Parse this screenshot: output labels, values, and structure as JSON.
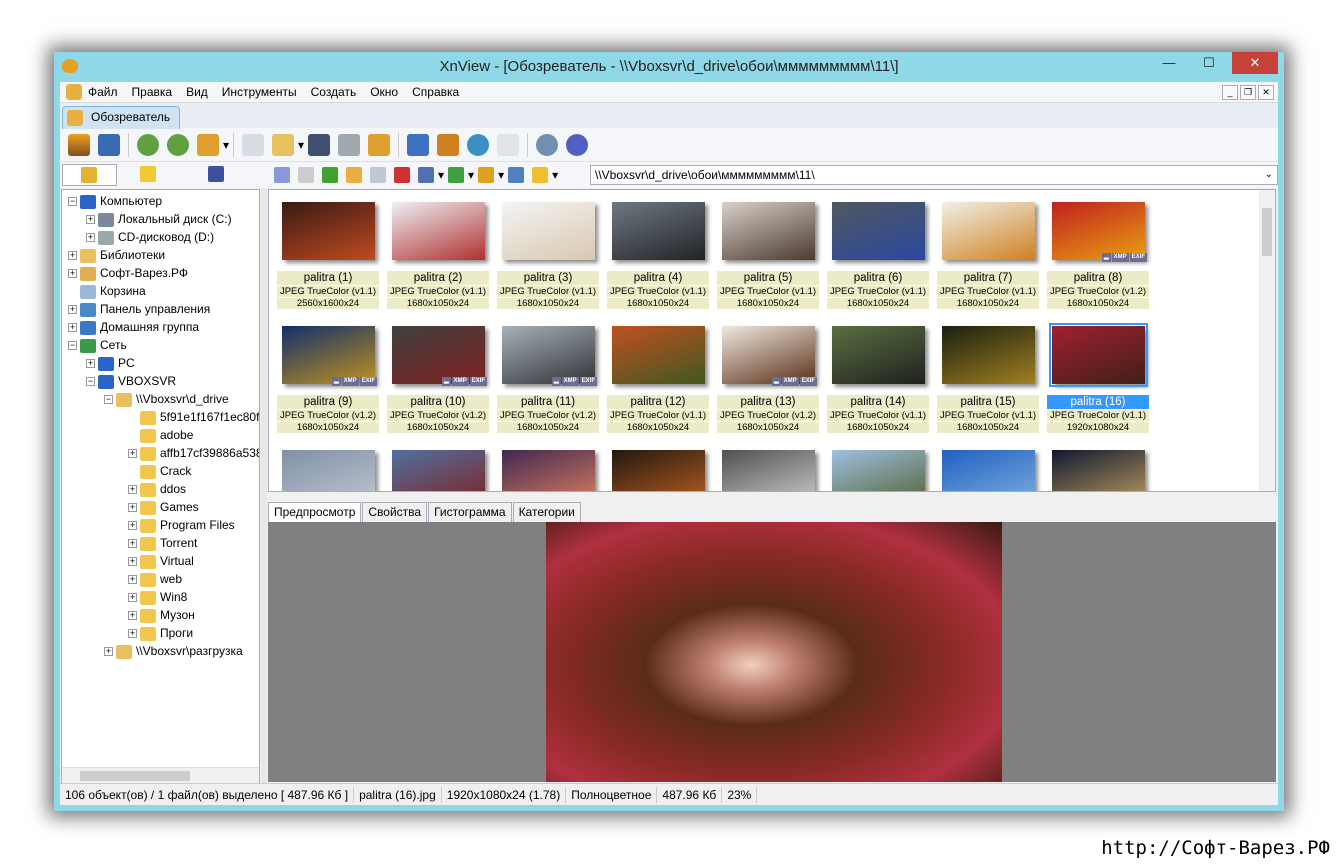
{
  "window": {
    "title": "XnView - [Обозреватель - \\\\Vboxsvr\\d_drive\\обои\\ммммммммм\\11\\]",
    "minimize": "—",
    "maximize": "☐",
    "close": "✕"
  },
  "menu": [
    "Файл",
    "Правка",
    "Вид",
    "Инструменты",
    "Создать",
    "Окно",
    "Справка"
  ],
  "doc_tab": "Обозреватель",
  "address": "\\\\Vboxsvr\\d_drive\\обои\\ммммммммм\\11\\",
  "tree": [
    {
      "label": "Компьютер",
      "level": 0,
      "exp": "-",
      "color": "#2a64c8"
    },
    {
      "label": "Локальный диск (C:)",
      "level": 1,
      "exp": "+",
      "color": "#7a8a9a"
    },
    {
      "label": "CD-дисковод (D:)",
      "level": 1,
      "exp": "+",
      "color": "#9aa"
    },
    {
      "label": "Библиотеки",
      "level": 0,
      "exp": "+",
      "color": "#e8c060"
    },
    {
      "label": "Софт-Варез.РФ",
      "level": 0,
      "exp": "+",
      "color": "#e0b050"
    },
    {
      "label": "Корзина",
      "level": 0,
      "exp": "",
      "color": "#9ab8d8"
    },
    {
      "label": "Панель управления",
      "level": 0,
      "exp": "+",
      "color": "#4a88c8"
    },
    {
      "label": "Домашняя группа",
      "level": 0,
      "exp": "+",
      "color": "#3a78c8"
    },
    {
      "label": "Сеть",
      "level": 0,
      "exp": "-",
      "color": "#3a9a48"
    },
    {
      "label": "PC",
      "level": 1,
      "exp": "+",
      "color": "#2a64c8"
    },
    {
      "label": "VBOXSVR",
      "level": 1,
      "exp": "-",
      "color": "#2a64c8"
    },
    {
      "label": "\\\\Vboxsvr\\d_drive",
      "level": 2,
      "exp": "-",
      "color": "#e8c060"
    },
    {
      "label": "5f91e1f167f1ec80f",
      "level": 3,
      "exp": "",
      "color": "#f0c850"
    },
    {
      "label": "adobe",
      "level": 3,
      "exp": "",
      "color": "#f0c850"
    },
    {
      "label": "affb17cf39886a538",
      "level": 3,
      "exp": "+",
      "color": "#f0c850"
    },
    {
      "label": "Crack",
      "level": 3,
      "exp": "",
      "color": "#f0c850"
    },
    {
      "label": "ddos",
      "level": 3,
      "exp": "+",
      "color": "#f0c850"
    },
    {
      "label": "Games",
      "level": 3,
      "exp": "+",
      "color": "#f0c850"
    },
    {
      "label": "Program Files",
      "level": 3,
      "exp": "+",
      "color": "#f0c850"
    },
    {
      "label": "Torrent",
      "level": 3,
      "exp": "+",
      "color": "#f0c850"
    },
    {
      "label": "Virtual",
      "level": 3,
      "exp": "+",
      "color": "#f0c850"
    },
    {
      "label": "web",
      "level": 3,
      "exp": "+",
      "color": "#f0c850"
    },
    {
      "label": "Win8",
      "level": 3,
      "exp": "+",
      "color": "#f0c850"
    },
    {
      "label": "Музон",
      "level": 3,
      "exp": "+",
      "color": "#f0c850"
    },
    {
      "label": "Проги",
      "level": 3,
      "exp": "+",
      "color": "#f0c850"
    },
    {
      "label": "\\\\Vboxsvr\\разгрузка",
      "level": 2,
      "exp": "+",
      "color": "#e8c060"
    }
  ],
  "thumbnails": [
    {
      "name": "palitra (1)",
      "format": "JPEG TrueColor (v1.1)",
      "dims": "2560x1600x24",
      "c": [
        "#3a1a14",
        "#c04a20"
      ],
      "badges": false
    },
    {
      "name": "palitra (2)",
      "format": "JPEG TrueColor (v1.1)",
      "dims": "1680x1050x24",
      "c": [
        "#eef0f4",
        "#b03030"
      ],
      "badges": false
    },
    {
      "name": "palitra (3)",
      "format": "JPEG TrueColor (v1.1)",
      "dims": "1680x1050x24",
      "c": [
        "#f4f4f4",
        "#d8c8b0"
      ],
      "badges": false
    },
    {
      "name": "palitra (4)",
      "format": "JPEG TrueColor (v1.1)",
      "dims": "1680x1050x24",
      "c": [
        "#707880",
        "#202428"
      ],
      "badges": false
    },
    {
      "name": "palitra (5)",
      "format": "JPEG TrueColor (v1.1)",
      "dims": "1680x1050x24",
      "c": [
        "#d8d0c8",
        "#4a3a30"
      ],
      "badges": false
    },
    {
      "name": "palitra (6)",
      "format": "JPEG TrueColor (v1.1)",
      "dims": "1680x1050x24",
      "c": [
        "#505860",
        "#2a48a0"
      ],
      "badges": false
    },
    {
      "name": "palitra (7)",
      "format": "JPEG TrueColor (v1.1)",
      "dims": "1680x1050x24",
      "c": [
        "#f0f0e8",
        "#d08020"
      ],
      "badges": false
    },
    {
      "name": "palitra (8)",
      "format": "JPEG TrueColor (v1.2)",
      "dims": "1680x1050x24",
      "c": [
        "#c02020",
        "#e8a010"
      ],
      "badges": true
    },
    {
      "name": "palitra (9)",
      "format": "JPEG TrueColor (v1.2)",
      "dims": "1680x1050x24",
      "c": [
        "#10306a",
        "#c09020"
      ],
      "badges": true
    },
    {
      "name": "palitra (10)",
      "format": "JPEG TrueColor (v1.2)",
      "dims": "1680x1050x24",
      "c": [
        "#404040",
        "#802020"
      ],
      "badges": true
    },
    {
      "name": "palitra (11)",
      "format": "JPEG TrueColor (v1.2)",
      "dims": "1680x1050x24",
      "c": [
        "#a8b0b8",
        "#303438"
      ],
      "badges": true
    },
    {
      "name": "palitra (12)",
      "format": "JPEG TrueColor (v1.1)",
      "dims": "1680x1050x24",
      "c": [
        "#c05020",
        "#405820"
      ],
      "badges": false
    },
    {
      "name": "palitra (13)",
      "format": "JPEG TrueColor (v1.2)",
      "dims": "1680x1050x24",
      "c": [
        "#f0e8e0",
        "#5a3018"
      ],
      "badges": true
    },
    {
      "name": "palitra (14)",
      "format": "JPEG TrueColor (v1.1)",
      "dims": "1680x1050x24",
      "c": [
        "#5a7040",
        "#202020"
      ],
      "badges": false
    },
    {
      "name": "palitra (15)",
      "format": "JPEG TrueColor (v1.1)",
      "dims": "1680x1050x24",
      "c": [
        "#1a2010",
        "#a08020"
      ],
      "badges": false
    },
    {
      "name": "palitra (16)",
      "format": "JPEG TrueColor (v1.1)",
      "dims": "1920x1080x24",
      "c": [
        "#a02030",
        "#402018"
      ],
      "badges": false,
      "selected": true
    },
    {
      "c": [
        "#8090a8",
        "#c0c8d0"
      ]
    },
    {
      "c": [
        "#5070a0",
        "#802020"
      ]
    },
    {
      "c": [
        "#402850",
        "#e08060"
      ]
    },
    {
      "c": [
        "#201810",
        "#c06020"
      ]
    },
    {
      "c": [
        "#505050",
        "#d0d0d0"
      ]
    },
    {
      "c": [
        "#a0c0e0",
        "#506030"
      ]
    },
    {
      "c": [
        "#2060c0",
        "#80b0e0"
      ]
    },
    {
      "c": [
        "#101830",
        "#c0a060"
      ]
    }
  ],
  "badge_labels": [
    "▂",
    "XMP",
    "EXIF"
  ],
  "preview_tabs": [
    "Предпросмотр",
    "Свойства",
    "Гистограмма",
    "Категории"
  ],
  "status": [
    "106 объект(ов) / 1 файл(ов) выделено  [ 487.96 Кб ]",
    "palitra (16).jpg",
    "1920x1080x24 (1.78)",
    "Полноцветное",
    "487.96 Кб",
    "23%"
  ],
  "watermark": "http://Софт-Варез.РФ"
}
